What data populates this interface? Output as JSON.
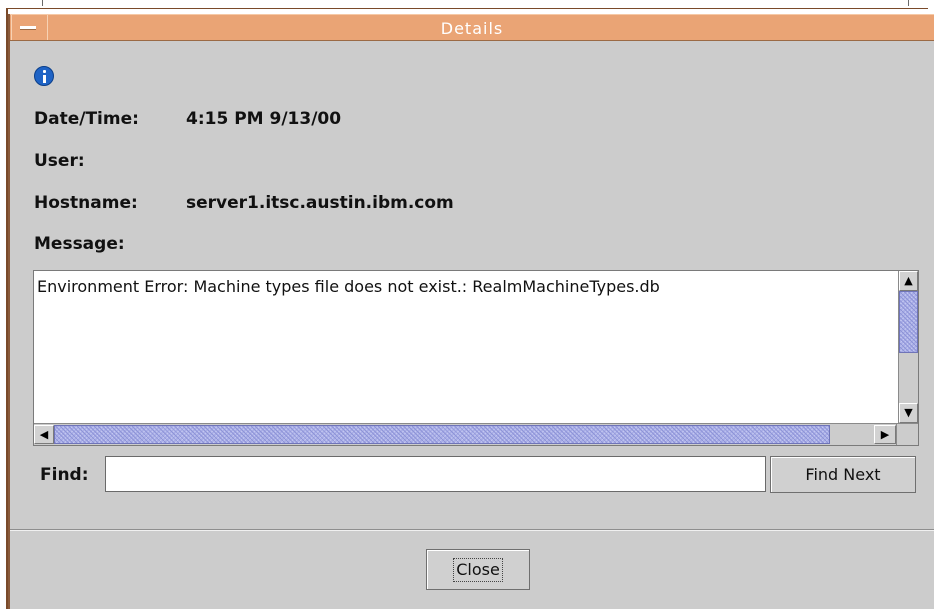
{
  "window": {
    "title": "Details"
  },
  "details": {
    "datetime_label": "Date/Time:",
    "datetime_value": "4:15 PM 9/13/00",
    "user_label": "User:",
    "user_value": "",
    "hostname_label": "Hostname:",
    "hostname_value": "server1.itsc.austin.ibm.com",
    "message_label": "Message:",
    "message_text": "Environment Error: Machine types file does not exist.: RealmMachineTypes.db"
  },
  "find": {
    "label": "Find:",
    "value": "",
    "button_label": "Find Next"
  },
  "footer": {
    "close_label": "Close"
  },
  "icons": {
    "info": "info-icon",
    "sysmenu": "window-menu-icon",
    "scroll_up": "▲",
    "scroll_down": "▼",
    "scroll_left": "◀",
    "scroll_right": "▶"
  },
  "colors": {
    "titlebar": "#eaa475",
    "background": "#cccccc",
    "scroll_thumb": "#a9aee6",
    "info_icon": "#1f63c5"
  }
}
